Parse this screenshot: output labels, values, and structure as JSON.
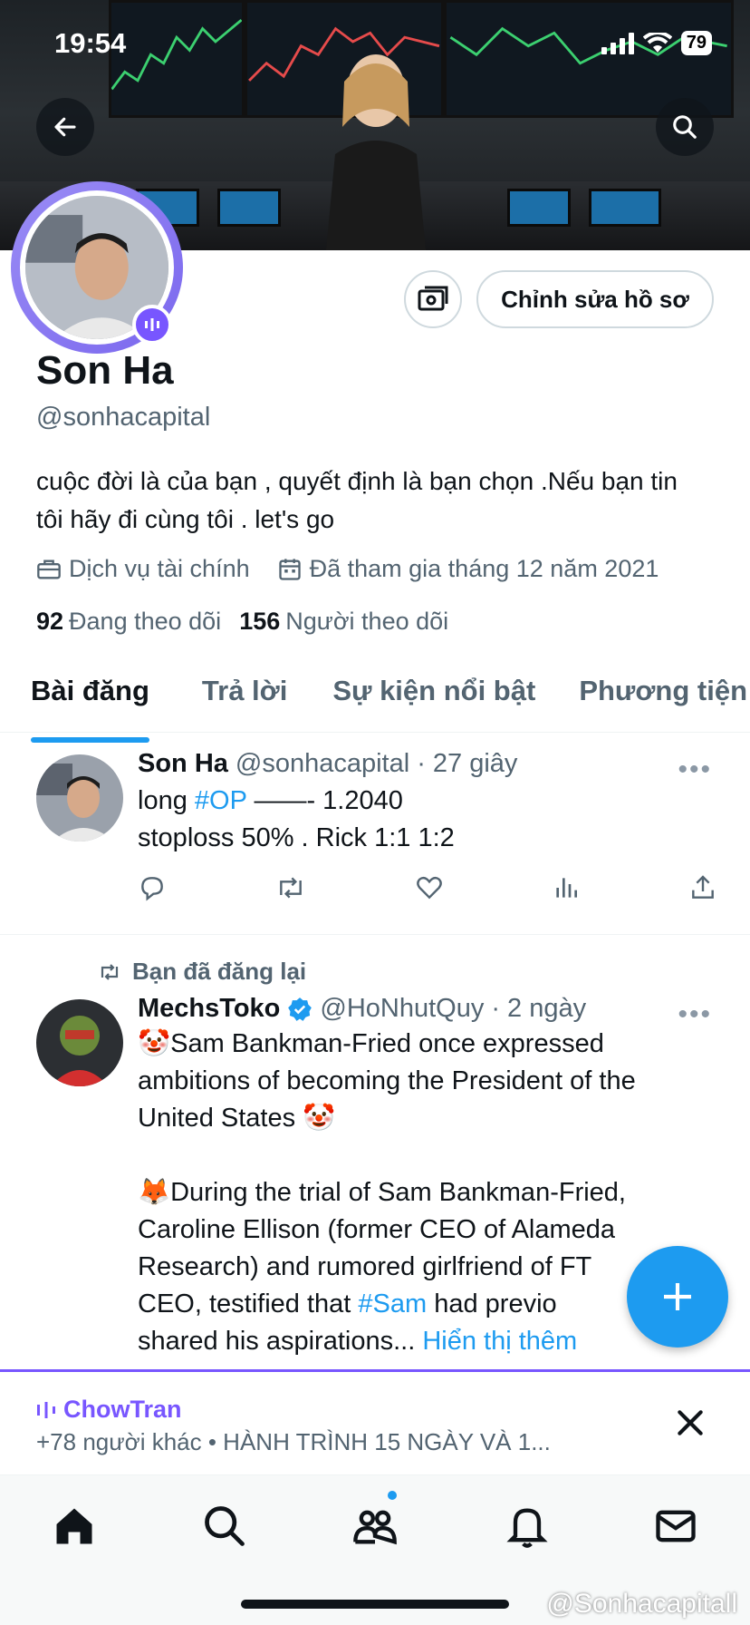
{
  "status_bar": {
    "time": "19:54",
    "battery": "79"
  },
  "profile": {
    "name": "Son Ha",
    "handle": "@sonhacapital",
    "bio": "cuộc đời là của bạn , quyết định là bạn chọn .Nếu bạn tin tôi hãy đi cùng tôi . let's go",
    "category": "Dịch vụ tài chính",
    "joined": "Đã tham gia tháng 12 năm 2021",
    "following_count": "92",
    "following_label": "Đang theo dõi",
    "followers_count": "156",
    "followers_label": "Người theo dõi",
    "edit_button": "Chỉnh sửa hồ sơ"
  },
  "tabs": [
    {
      "label": "Bài đăng",
      "active": true
    },
    {
      "label": "Trả lời",
      "active": false
    },
    {
      "label": "Sự kiện nổi bật",
      "active": false
    },
    {
      "label": "Phương tiện",
      "active": false
    }
  ],
  "posts": [
    {
      "name": "Son Ha",
      "handle": "@sonhacapital",
      "time": "· 27 giây",
      "line1_prefix": "long ",
      "line1_tag": "#OP",
      "line1_suffix": " ——- 1.2040",
      "line2": "stoploss 50% . Rick 1:1 1:2"
    },
    {
      "repost_label": "Bạn đã đăng lại",
      "name": "MechsToko",
      "handle": "@HoNhutQuy",
      "time": "· 2 ngày",
      "para1": "🤡Sam Bankman-Fried once expressed ambitions of becoming the President of the United States 🤡",
      "para2_a": " 🦊During the trial of Sam Bankman-Fried, Caroline Ellison (former CEO of Alameda Research) and rumored girlfriend of FT",
      "para2_b": "CEO, testified that ",
      "para2_tag": "#Sam",
      "para2_c": " had previo",
      "para2_d": "shared his aspirations... ",
      "show_more": "Hiển thị thêm"
    }
  ],
  "space": {
    "host": "ChowTran",
    "subtitle": "+78 người khác • HÀNH TRÌNH 15 NGÀY VÀ 1..."
  },
  "watermark": "@Sonhacapitall",
  "colors": {
    "accent": "#1d9bf0",
    "spaces": "#7856ff",
    "text": "#0f1419",
    "secondary": "#536471"
  },
  "icons": [
    "back-arrow-icon",
    "search-icon",
    "money-icon",
    "briefcase-icon",
    "calendar-icon",
    "reply-icon",
    "repost-icon",
    "like-icon",
    "views-icon",
    "share-icon",
    "more-icon",
    "verified-icon",
    "home-icon",
    "explore-icon",
    "communities-icon",
    "notifications-icon",
    "messages-icon",
    "close-icon",
    "compose-plus-icon"
  ]
}
